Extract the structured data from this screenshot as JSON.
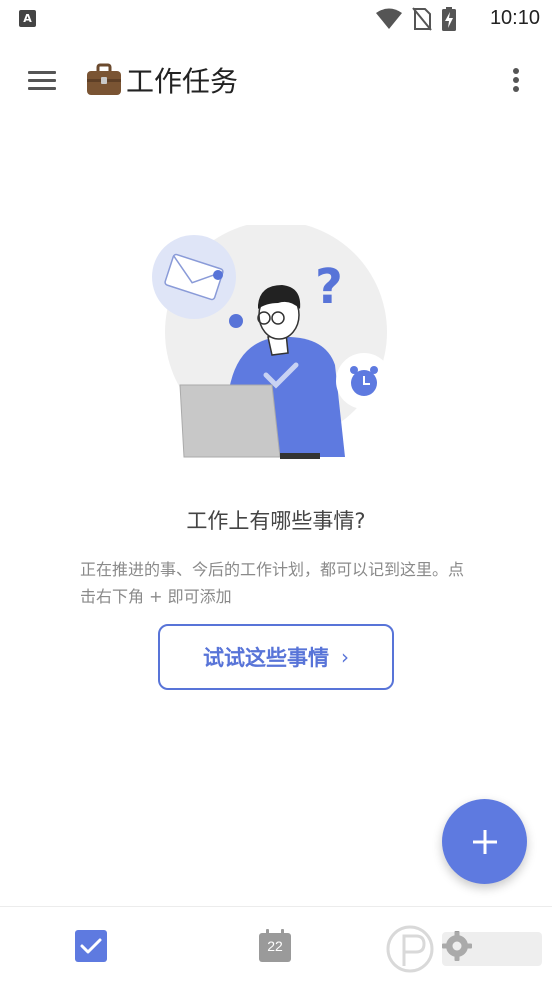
{
  "status_bar": {
    "app_badge": "A",
    "time": "10:10"
  },
  "app_bar": {
    "title_emoji": "💼",
    "title": "工作任务"
  },
  "empty_state": {
    "title": "工作上有哪些事情?",
    "description": "正在推进的事、今后的工作计划，都可以记到这里。点击右下角 + 即可添加",
    "try_button_label": "试试这些事情",
    "try_button_chevron": "›"
  },
  "bottom_nav": {
    "calendar_day": "22",
    "active_tab": "tasks"
  },
  "colors": {
    "accent": "#5e7ae0",
    "text_primary": "#222222",
    "text_secondary": "#8a8a8a",
    "icon_gray": "#9a9a9a"
  }
}
